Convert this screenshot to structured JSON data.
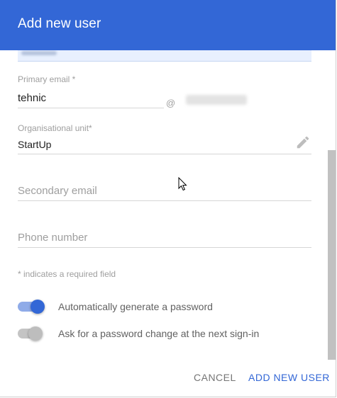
{
  "dialog": {
    "title": "Add new user"
  },
  "form": {
    "primary_email": {
      "label": "Primary email *",
      "value": "tehnic",
      "at_symbol": "@"
    },
    "org_unit": {
      "label": "Organisational unit*",
      "value": "StartUp"
    },
    "secondary_email": {
      "placeholder": "Secondary email"
    },
    "phone": {
      "placeholder": "Phone number"
    },
    "required_hint": "* indicates a required field"
  },
  "toggles": {
    "auto_password": {
      "label": "Automatically generate a password",
      "state": "on"
    },
    "change_password": {
      "label": "Ask for a password change at the next sign-in",
      "state": "off"
    }
  },
  "actions": {
    "cancel_label": "CANCEL",
    "add_label": "ADD NEW USER"
  },
  "colors": {
    "accent": "#3367d6",
    "header_text": "#ffffff",
    "label_gray": "#9e9e9e"
  }
}
